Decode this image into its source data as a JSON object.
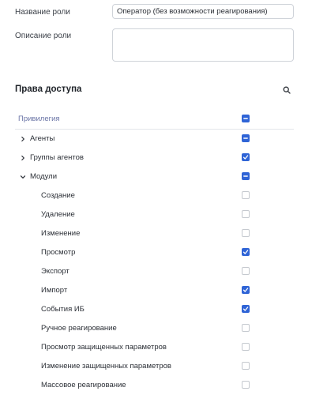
{
  "form": {
    "role_name_label": "Название роли",
    "role_name_value": "Оператор (без возможности реагирования)",
    "role_description_label": "Описание роли",
    "role_description_value": ""
  },
  "permissions": {
    "title": "Права доступа",
    "search_icon": "search-icon",
    "header": {
      "label": "Привилегия",
      "state": "indeterminate"
    },
    "rows": [
      {
        "label": "Агенты",
        "level": 0,
        "expander": "collapsed",
        "state": "indeterminate"
      },
      {
        "label": "Группы агентов",
        "level": 0,
        "expander": "collapsed",
        "state": "checked"
      },
      {
        "label": "Модули",
        "level": 0,
        "expander": "expanded",
        "state": "indeterminate"
      },
      {
        "label": "Создание",
        "level": 1,
        "expander": "none",
        "state": "unchecked"
      },
      {
        "label": "Удаление",
        "level": 1,
        "expander": "none",
        "state": "unchecked"
      },
      {
        "label": "Изменение",
        "level": 1,
        "expander": "none",
        "state": "unchecked"
      },
      {
        "label": "Просмотр",
        "level": 1,
        "expander": "none",
        "state": "checked"
      },
      {
        "label": "Экспорт",
        "level": 1,
        "expander": "none",
        "state": "unchecked"
      },
      {
        "label": "Импорт",
        "level": 1,
        "expander": "none",
        "state": "checked"
      },
      {
        "label": "События ИБ",
        "level": 1,
        "expander": "none",
        "state": "checked"
      },
      {
        "label": "Ручное реагирование",
        "level": 1,
        "expander": "none",
        "state": "unchecked"
      },
      {
        "label": "Просмотр защищенных параметров",
        "level": 1,
        "expander": "none",
        "state": "unchecked"
      },
      {
        "label": "Изменение защищенных параметров",
        "level": 1,
        "expander": "none",
        "state": "unchecked"
      },
      {
        "label": "Массовое реагирование",
        "level": 1,
        "expander": "none",
        "state": "unchecked"
      }
    ]
  },
  "colors": {
    "accent": "#2f64d6",
    "header_text": "#6a74a6",
    "border": "#cfd3d9"
  }
}
